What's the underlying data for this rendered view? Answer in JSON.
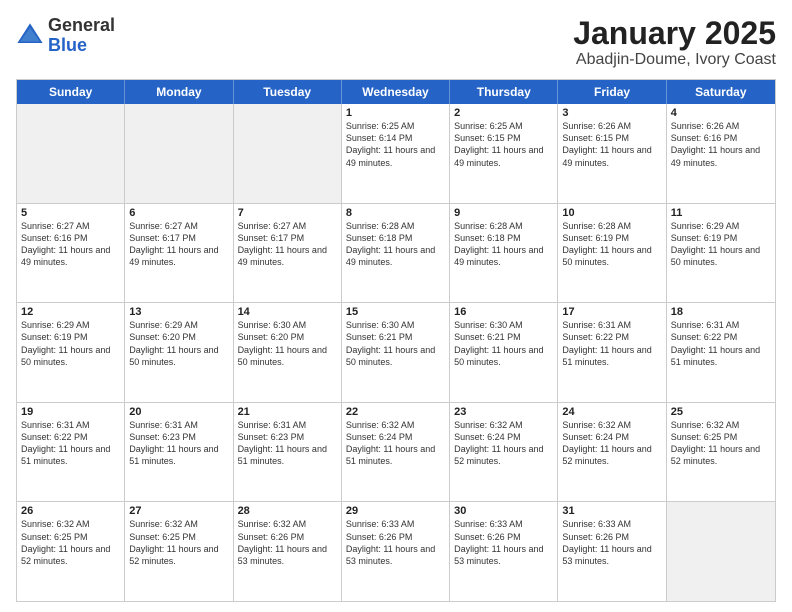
{
  "logo": {
    "general": "General",
    "blue": "Blue"
  },
  "title": "January 2025",
  "subtitle": "Abadjin-Doume, Ivory Coast",
  "days": [
    "Sunday",
    "Monday",
    "Tuesday",
    "Wednesday",
    "Thursday",
    "Friday",
    "Saturday"
  ],
  "weeks": [
    [
      {
        "day": "",
        "info": ""
      },
      {
        "day": "",
        "info": ""
      },
      {
        "day": "",
        "info": ""
      },
      {
        "day": "1",
        "info": "Sunrise: 6:25 AM\nSunset: 6:14 PM\nDaylight: 11 hours and 49 minutes."
      },
      {
        "day": "2",
        "info": "Sunrise: 6:25 AM\nSunset: 6:15 PM\nDaylight: 11 hours and 49 minutes."
      },
      {
        "day": "3",
        "info": "Sunrise: 6:26 AM\nSunset: 6:15 PM\nDaylight: 11 hours and 49 minutes."
      },
      {
        "day": "4",
        "info": "Sunrise: 6:26 AM\nSunset: 6:16 PM\nDaylight: 11 hours and 49 minutes."
      }
    ],
    [
      {
        "day": "5",
        "info": "Sunrise: 6:27 AM\nSunset: 6:16 PM\nDaylight: 11 hours and 49 minutes."
      },
      {
        "day": "6",
        "info": "Sunrise: 6:27 AM\nSunset: 6:17 PM\nDaylight: 11 hours and 49 minutes."
      },
      {
        "day": "7",
        "info": "Sunrise: 6:27 AM\nSunset: 6:17 PM\nDaylight: 11 hours and 49 minutes."
      },
      {
        "day": "8",
        "info": "Sunrise: 6:28 AM\nSunset: 6:18 PM\nDaylight: 11 hours and 49 minutes."
      },
      {
        "day": "9",
        "info": "Sunrise: 6:28 AM\nSunset: 6:18 PM\nDaylight: 11 hours and 49 minutes."
      },
      {
        "day": "10",
        "info": "Sunrise: 6:28 AM\nSunset: 6:19 PM\nDaylight: 11 hours and 50 minutes."
      },
      {
        "day": "11",
        "info": "Sunrise: 6:29 AM\nSunset: 6:19 PM\nDaylight: 11 hours and 50 minutes."
      }
    ],
    [
      {
        "day": "12",
        "info": "Sunrise: 6:29 AM\nSunset: 6:19 PM\nDaylight: 11 hours and 50 minutes."
      },
      {
        "day": "13",
        "info": "Sunrise: 6:29 AM\nSunset: 6:20 PM\nDaylight: 11 hours and 50 minutes."
      },
      {
        "day": "14",
        "info": "Sunrise: 6:30 AM\nSunset: 6:20 PM\nDaylight: 11 hours and 50 minutes."
      },
      {
        "day": "15",
        "info": "Sunrise: 6:30 AM\nSunset: 6:21 PM\nDaylight: 11 hours and 50 minutes."
      },
      {
        "day": "16",
        "info": "Sunrise: 6:30 AM\nSunset: 6:21 PM\nDaylight: 11 hours and 50 minutes."
      },
      {
        "day": "17",
        "info": "Sunrise: 6:31 AM\nSunset: 6:22 PM\nDaylight: 11 hours and 51 minutes."
      },
      {
        "day": "18",
        "info": "Sunrise: 6:31 AM\nSunset: 6:22 PM\nDaylight: 11 hours and 51 minutes."
      }
    ],
    [
      {
        "day": "19",
        "info": "Sunrise: 6:31 AM\nSunset: 6:22 PM\nDaylight: 11 hours and 51 minutes."
      },
      {
        "day": "20",
        "info": "Sunrise: 6:31 AM\nSunset: 6:23 PM\nDaylight: 11 hours and 51 minutes."
      },
      {
        "day": "21",
        "info": "Sunrise: 6:31 AM\nSunset: 6:23 PM\nDaylight: 11 hours and 51 minutes."
      },
      {
        "day": "22",
        "info": "Sunrise: 6:32 AM\nSunset: 6:24 PM\nDaylight: 11 hours and 51 minutes."
      },
      {
        "day": "23",
        "info": "Sunrise: 6:32 AM\nSunset: 6:24 PM\nDaylight: 11 hours and 52 minutes."
      },
      {
        "day": "24",
        "info": "Sunrise: 6:32 AM\nSunset: 6:24 PM\nDaylight: 11 hours and 52 minutes."
      },
      {
        "day": "25",
        "info": "Sunrise: 6:32 AM\nSunset: 6:25 PM\nDaylight: 11 hours and 52 minutes."
      }
    ],
    [
      {
        "day": "26",
        "info": "Sunrise: 6:32 AM\nSunset: 6:25 PM\nDaylight: 11 hours and 52 minutes."
      },
      {
        "day": "27",
        "info": "Sunrise: 6:32 AM\nSunset: 6:25 PM\nDaylight: 11 hours and 52 minutes."
      },
      {
        "day": "28",
        "info": "Sunrise: 6:32 AM\nSunset: 6:26 PM\nDaylight: 11 hours and 53 minutes."
      },
      {
        "day": "29",
        "info": "Sunrise: 6:33 AM\nSunset: 6:26 PM\nDaylight: 11 hours and 53 minutes."
      },
      {
        "day": "30",
        "info": "Sunrise: 6:33 AM\nSunset: 6:26 PM\nDaylight: 11 hours and 53 minutes."
      },
      {
        "day": "31",
        "info": "Sunrise: 6:33 AM\nSunset: 6:26 PM\nDaylight: 11 hours and 53 minutes."
      },
      {
        "day": "",
        "info": ""
      }
    ]
  ]
}
